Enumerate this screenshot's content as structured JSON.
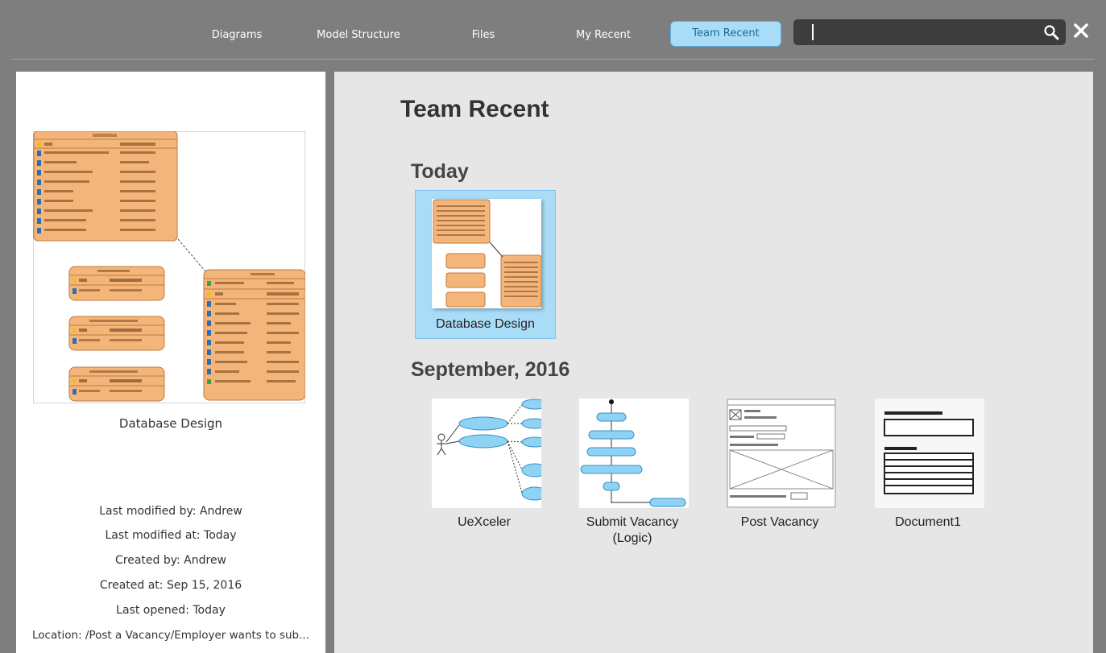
{
  "nav": {
    "tabs": [
      {
        "label": "Diagrams"
      },
      {
        "label": "Model Structure"
      },
      {
        "label": "Files"
      },
      {
        "label": "My Recent"
      },
      {
        "label": "Team Recent"
      }
    ],
    "search_value": "",
    "close_icon": "close-icon",
    "search_icon": "search-icon"
  },
  "preview": {
    "title": "Database Design",
    "last_modified_by": "Last modified by: Andrew",
    "last_modified_at": "Last modified at: Today",
    "created_by": "Created by: Andrew",
    "created_at": "Created at: Sep 15, 2016",
    "last_opened": "Last opened: Today",
    "location": "Location: /Post a Vacancy/Employer wants to sub..."
  },
  "main": {
    "heading": "Team Recent",
    "groups": [
      {
        "title": "Today",
        "items": [
          {
            "label": "Database Design",
            "selected": true
          }
        ]
      },
      {
        "title": "September, 2016",
        "items": [
          {
            "label": "UeXceler"
          },
          {
            "label_line1": "Submit Vacancy",
            "label_line2": "(Logic)"
          },
          {
            "label": "Post Vacancy"
          },
          {
            "label": "Document1"
          }
        ]
      }
    ]
  },
  "colors": {
    "background": "#7e7e7e",
    "active_tab": "#a9dcf6",
    "entity_fill": "#f4b57a",
    "entity_border": "#c07a3c",
    "panel": "#e6e6e6",
    "node_fill": "#8fd3f4"
  }
}
